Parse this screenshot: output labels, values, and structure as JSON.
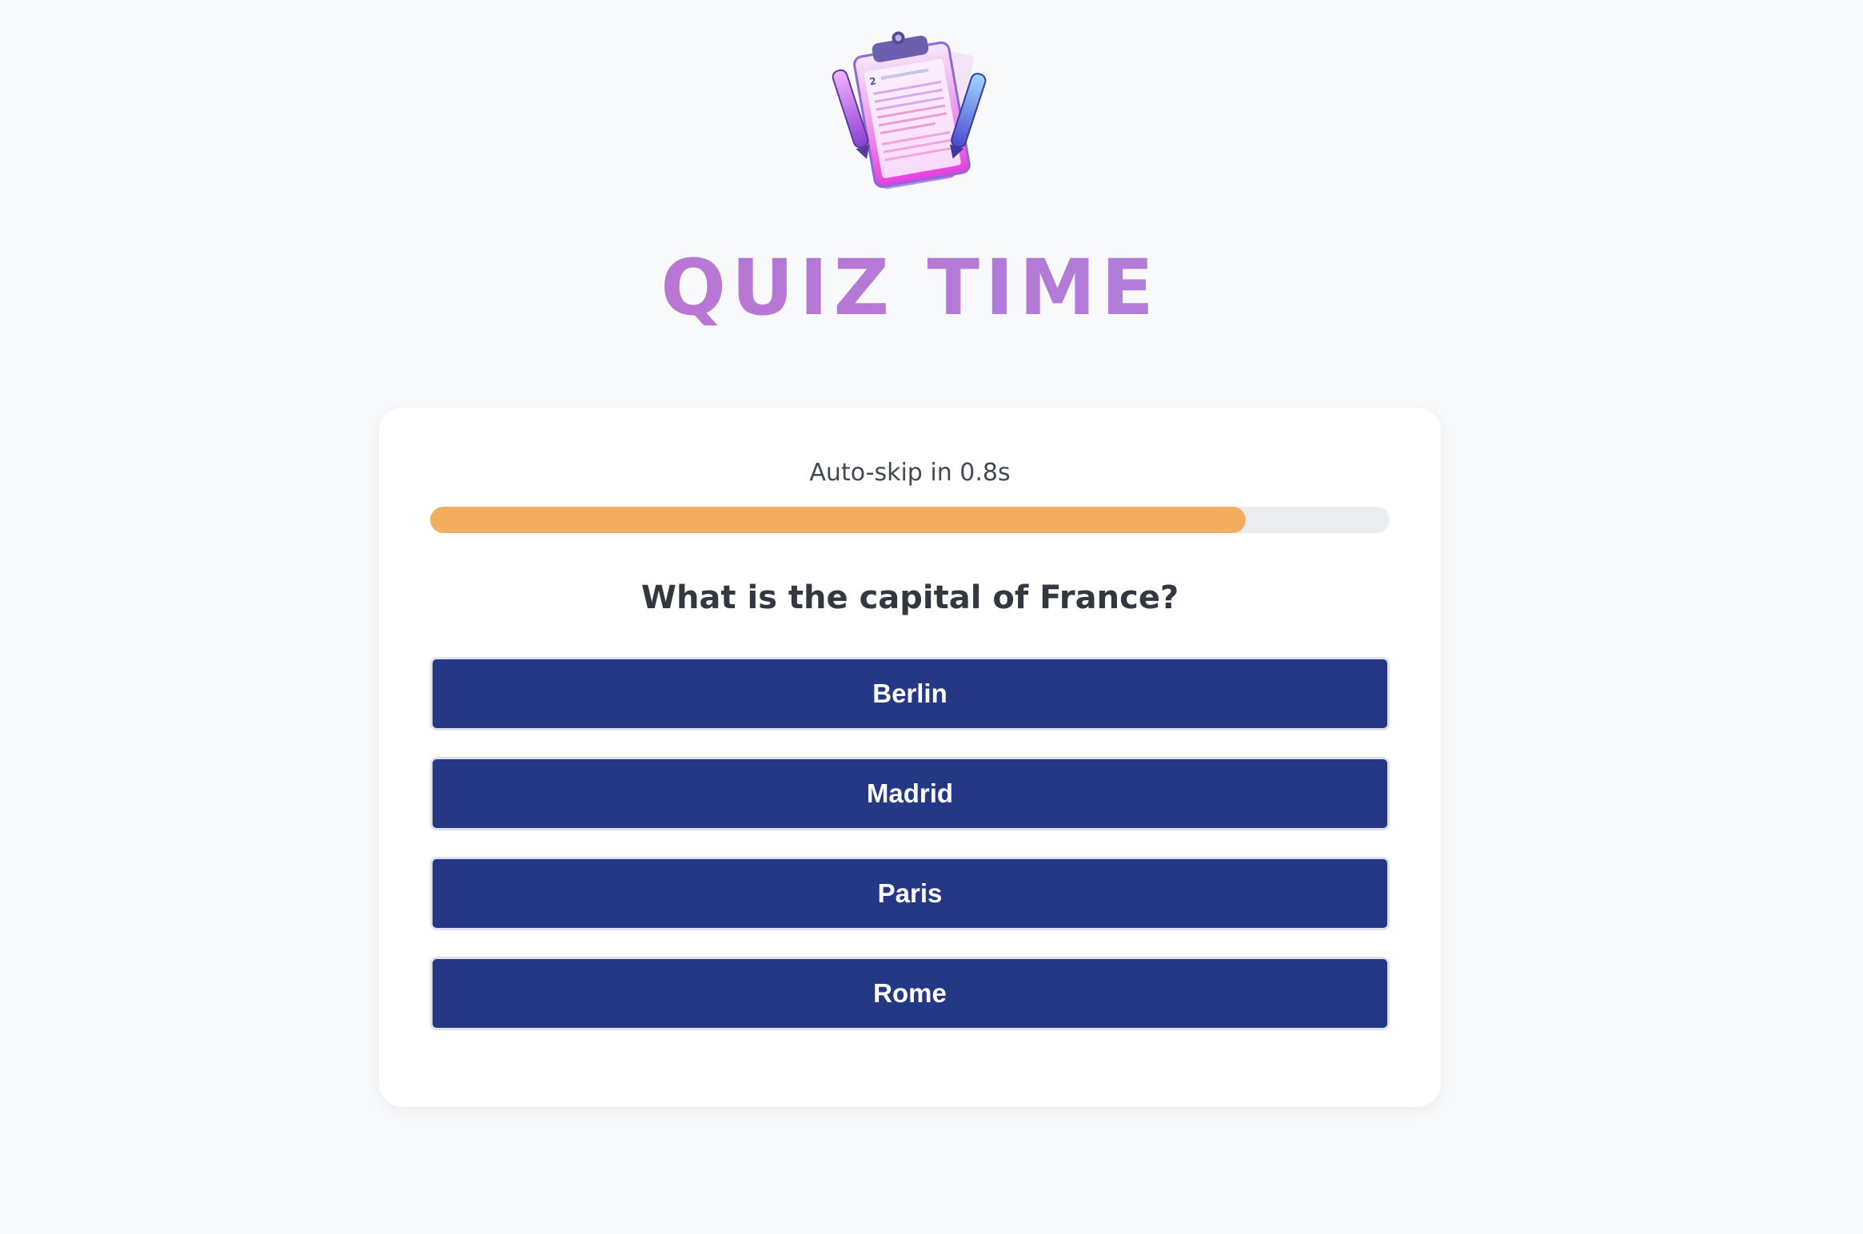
{
  "header": {
    "title": "QUIZ TIME",
    "logo_icon": "clipboard-with-pens-icon"
  },
  "timer": {
    "text": "Auto-skip in 0.8s",
    "progress": 0.85,
    "color": "#f3ad5e"
  },
  "question": {
    "text": "What is the capital of France?"
  },
  "answers": [
    {
      "label": "Berlin"
    },
    {
      "label": "Madrid"
    },
    {
      "label": "Paris"
    },
    {
      "label": "Rome"
    }
  ],
  "colors": {
    "answer_bg": "#253885",
    "title_gradient_start": "#c070c8",
    "title_gradient_end": "#a685e0"
  }
}
